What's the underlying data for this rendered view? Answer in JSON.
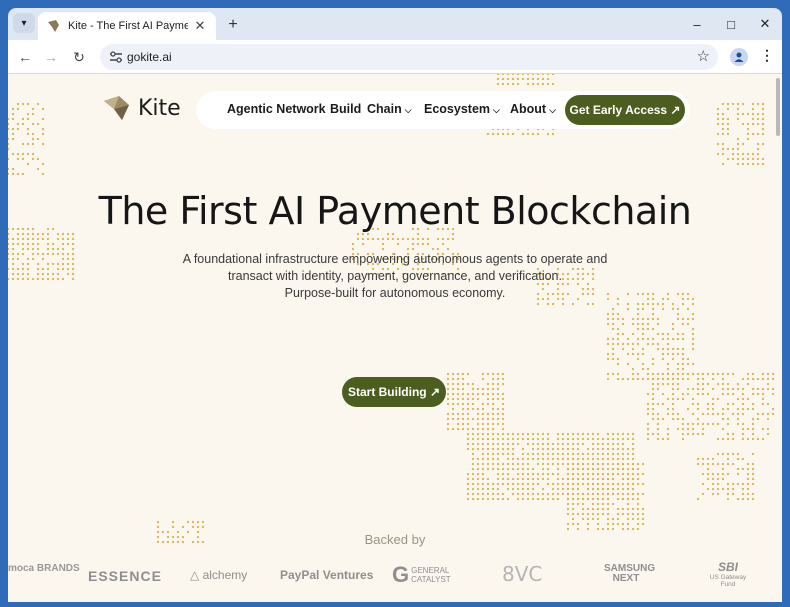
{
  "browser": {
    "tab_title": "Kite - The First AI Payment Bloc",
    "tab_menu_icon": "chevron-down-icon",
    "url": "gokite.ai",
    "window_controls": {
      "minimize": "–",
      "maximize": "□",
      "close": "✕"
    }
  },
  "site": {
    "logo_text": "Kite",
    "nav": [
      {
        "label": "Agentic Network",
        "has_caret": false
      },
      {
        "label": "Build",
        "has_caret": false
      },
      {
        "label": "Chain",
        "has_caret": true
      },
      {
        "label": "Ecosystem",
        "has_caret": true
      },
      {
        "label": "About",
        "has_caret": true
      }
    ],
    "cta_label": "Get Early Access ↗",
    "headline": "The First AI Payment Blockchain",
    "subline_1": "A foundational infrastructure empowering autonomous agents to operate and",
    "subline_2": "transact with identity, payment, governance, and verification.",
    "subline_3": "Purpose-built for autonomous economy.",
    "start_label": "Start Building ↗",
    "backed_by": "Backed by",
    "backers": [
      "moca BRANDS",
      "ESSENCE",
      "alchemy",
      "PayPal Ventures",
      "GENERAL CATALYST",
      "8VC",
      "SAMSUNG NEXT",
      "SBI",
      "US Gateway Fund"
    ]
  },
  "colors": {
    "accent": "#4b5e1f",
    "page_bg": "#fbf6ee",
    "dots": "#d9b24a"
  }
}
